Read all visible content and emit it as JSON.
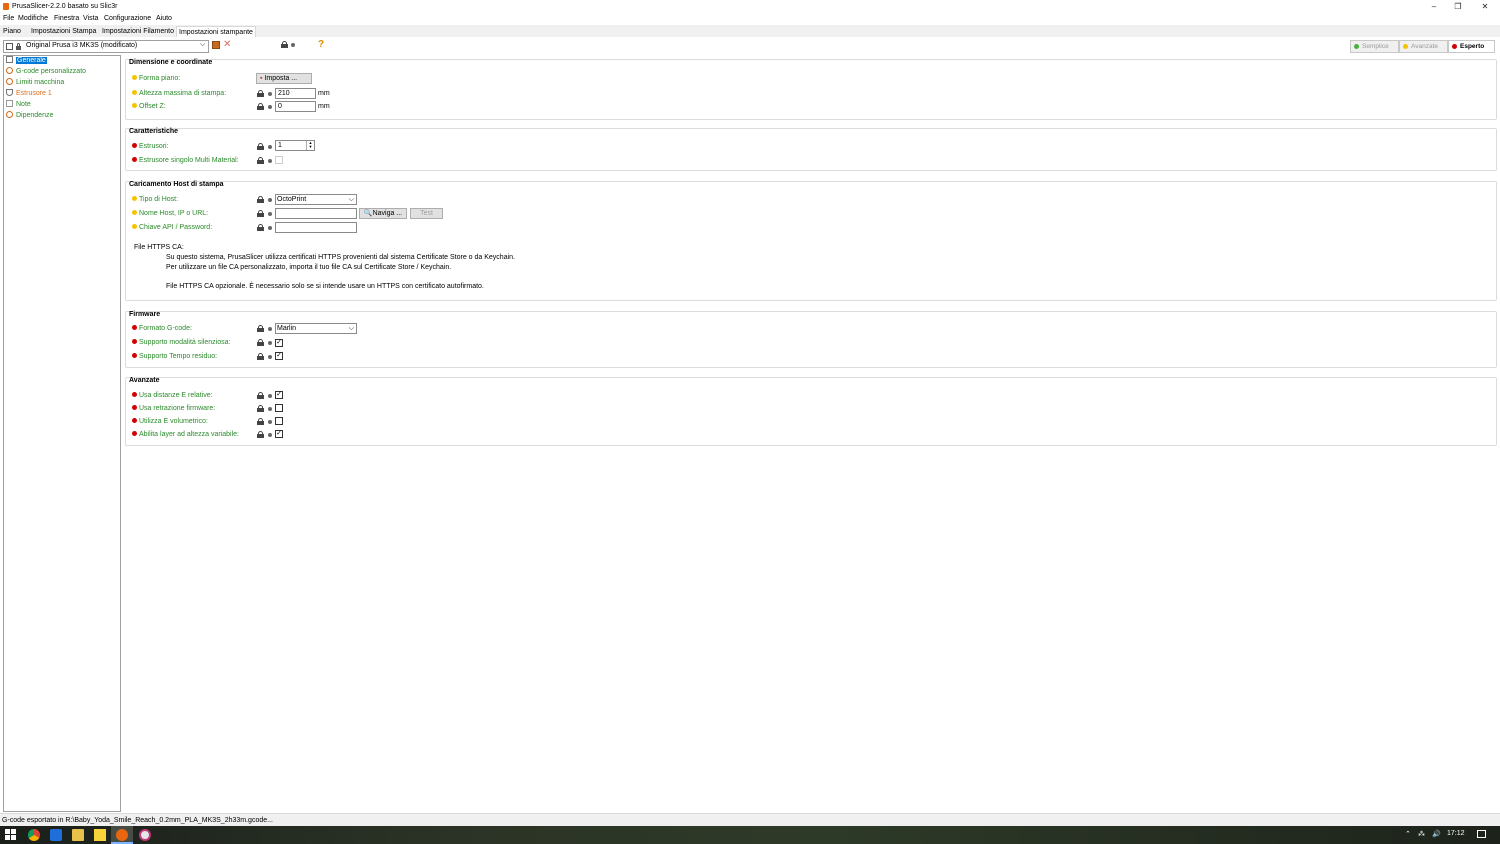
{
  "window": {
    "title": "PrusaSlicer-2.2.0 basato su Slic3r",
    "min": "–",
    "restore": "❐",
    "close": "✕"
  },
  "menu": [
    "File",
    "Modifiche",
    "Finestra",
    "Vista",
    "Configurazione",
    "Aiuto"
  ],
  "tabs": [
    "Piano",
    "Impostazioni Stampa",
    "Impostazioni Filamento",
    "Impostazioni stampante"
  ],
  "preset": {
    "name": "Original Prusa i3 MK3S (modificato)",
    "help": "?"
  },
  "modes": [
    "Semplice",
    "Avanzate",
    "Esperto"
  ],
  "colors": {
    "yellow": "#f5c400",
    "red": "#d20000",
    "green": "#47b23a",
    "accent": "#0078d7",
    "label_green": "#2c8a2c"
  },
  "sidebar": [
    {
      "label": "Generale",
      "color": "#ffffff"
    },
    {
      "label": "G-code personalizzato",
      "color": "#2c8a2c"
    },
    {
      "label": "Limiti macchina",
      "color": "#2c8a2c"
    },
    {
      "label": "Estrusore 1",
      "color": "#e07020"
    },
    {
      "label": "Note",
      "color": "#2c8a2c"
    },
    {
      "label": "Dipendenze",
      "color": "#2c8a2c"
    }
  ],
  "groups": {
    "dim": {
      "title": "Dimensione e coordinate",
      "bed_shape": "Forma piano:",
      "bed_button": "Imposta ...",
      "max_height": "Altezza massima di stampa:",
      "max_height_value": "210",
      "z_offset": "Offset Z:",
      "z_offset_value": "0",
      "unit": "mm"
    },
    "car": {
      "title": "Caratteristiche",
      "extruders": "Estrusori:",
      "extruders_value": "1",
      "single_mm": "Estrusore singolo Multi Material:"
    },
    "host": {
      "title": "Caricamento Host di stampa",
      "host_type": "Tipo di Host:",
      "host_type_value": "OctoPrint",
      "hostname": "Nome Host, IP o URL:",
      "browse": "Naviga ...",
      "test": "Test",
      "apikey": "Chiave API / Password:",
      "https_label": "File HTTPS CA:",
      "info1": "Su questo sistema, PrusaSlicer utilizza certificati HTTPS provenienti dal sistema Certificate Store o da Keychain.",
      "info2": "Per utilizzare un file CA personalizzato, importa il tuo file CA sul Certificate Store / Keychain.",
      "info3": "File HTTPS CA opzionale. È necessario solo se si intende usare un HTTPS con certificato autofirmato."
    },
    "fw": {
      "title": "Firmware",
      "gcode_flavor": "Formato G-code:",
      "gcode_flavor_value": "Marlin",
      "silent": "Supporto modalità silenziosa:",
      "remaining": "Supporto Tempo residuo:"
    },
    "adv": {
      "title": "Avanzate",
      "rel_e": "Usa distanze E relative:",
      "fw_retract": "Usa retrazione firmware:",
      "vol_e": "Utilizza E volumetrico:",
      "var_layer": "Abilita layer ad altezza variabile:"
    }
  },
  "status": "G-code esportato in R:\\Baby_Yoda_Smile_Reach_0.2mm_PLA_MK3S_2h33m.gcode...",
  "taskbar": {
    "time": "17:12"
  }
}
